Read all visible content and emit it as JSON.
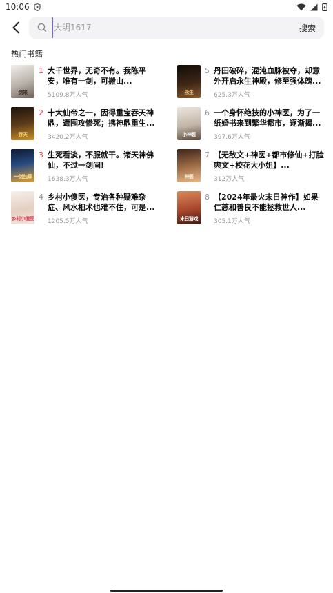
{
  "status": {
    "time": "10:06"
  },
  "search": {
    "placeholder": "大明1617",
    "submit_label": "搜索"
  },
  "section_title": "热门书籍",
  "books": [
    {
      "rank": "1",
      "title": "大千世界，无奇不有。我陈平安，唯有一剑，可搬山...",
      "popularity": "5109.8万人气",
      "cover_text": "剑来",
      "cover_color": "#d9d3cc"
    },
    {
      "rank": "2",
      "title": "十大仙帝之一，因得重宝吞天神鼎，遭围攻惨死；携神鼎重生...",
      "popularity": "3420.2万人气",
      "cover_text": "吞天",
      "cover_color": "#3a2a18"
    },
    {
      "rank": "3",
      "title": "生死看淡，不服就干。诸天神佛仙，不过一剑间!",
      "popularity": "1638.3万人气",
      "cover_text": "一剑独尊",
      "cover_color": "#1f3355"
    },
    {
      "rank": "4",
      "title": "乡村小傻医，专治各种疑难杂症、风水相术也难不住，可是...",
      "popularity": "1205.5万人气",
      "cover_text": "乡村小傻医",
      "cover_color": "#e9dcd3"
    },
    {
      "rank": "5",
      "title": "丹田破碎，混沌血脉被夺，却意外开启永生神殿，修至强体魄...",
      "popularity": "625.3万人气",
      "cover_text": "永生",
      "cover_color": "#2a1c12"
    },
    {
      "rank": "6",
      "title": "一个身怀绝技的小神医，为了一纸婚书来到繁华都市，逐渐揭...",
      "popularity": "397.6万人气",
      "cover_text": "小神医",
      "cover_color": "#cfc6bd"
    },
    {
      "rank": "7",
      "title": "【无敌文+神医+都市修仙+打脸爽文+校花大小姐】...",
      "popularity": "312万人气",
      "cover_text": "神医",
      "cover_color": "#8a5a3b"
    },
    {
      "rank": "8",
      "title": "【2024年最火末日神作】如果仁慈和善良不能拯救世人...",
      "popularity": "305.1万人气",
      "cover_text": "末日游戏",
      "cover_color": "#b2573a"
    }
  ]
}
